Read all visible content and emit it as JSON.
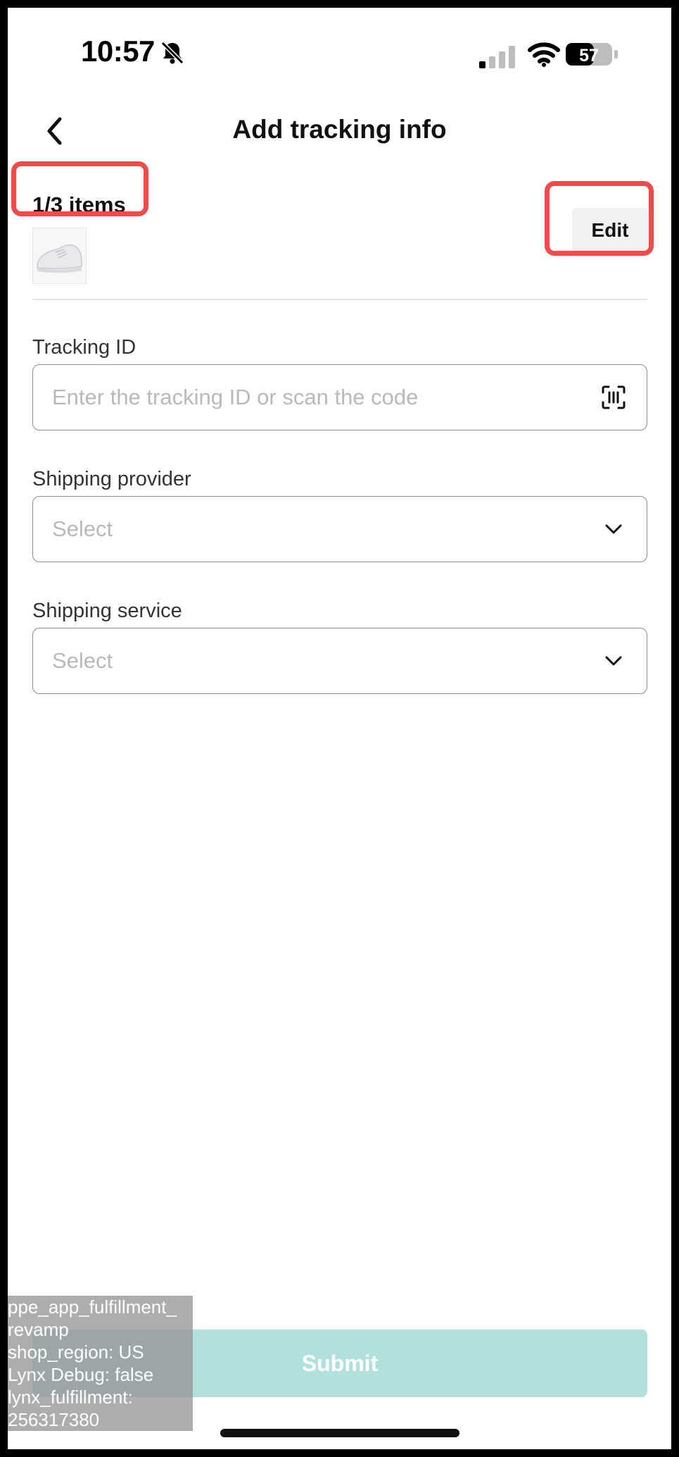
{
  "status_bar": {
    "time": "10:57",
    "battery": "57"
  },
  "header": {
    "title": "Add tracking info"
  },
  "items": {
    "count_label": "1/3 items",
    "edit_label": "Edit",
    "thumbnail": "white sneaker product image"
  },
  "form": {
    "tracking_id": {
      "label": "Tracking ID",
      "placeholder": "Enter the tracking ID or scan the code"
    },
    "shipping_provider": {
      "label": "Shipping provider",
      "value": "Select"
    },
    "shipping_service": {
      "label": "Shipping service",
      "value": "Select"
    }
  },
  "submit_label": "Submit",
  "debug_overlay": {
    "text": "ppe_app_fulfillment_\nrevamp\nshop_region: US\nLynx Debug: false\nlynx_fulfillment:\n256317380"
  },
  "colors": {
    "highlight": "#ef4b4b",
    "submit_bg": "#b2e0dd"
  }
}
